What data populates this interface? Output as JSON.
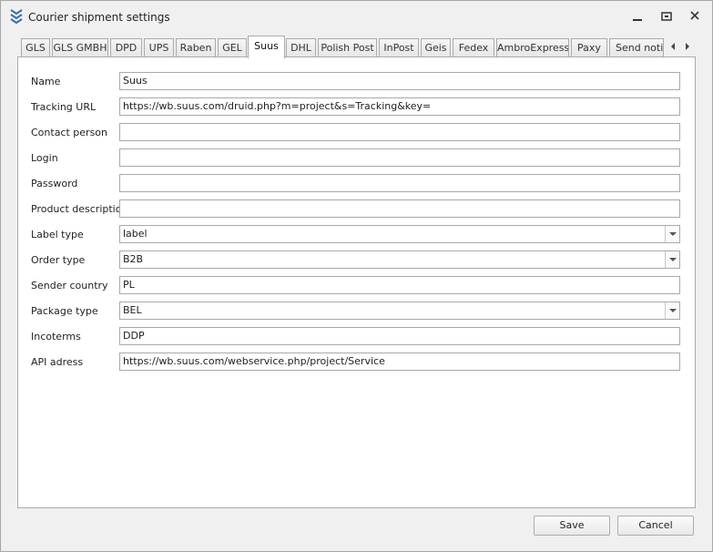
{
  "window": {
    "title": "Courier shipment settings"
  },
  "tabs": [
    {
      "label": "GLS",
      "active": false
    },
    {
      "label": "GLS GMBH",
      "active": false
    },
    {
      "label": "DPD",
      "active": false
    },
    {
      "label": "UPS",
      "active": false
    },
    {
      "label": "Raben",
      "active": false
    },
    {
      "label": "GEL",
      "active": false
    },
    {
      "label": "Suus",
      "active": true
    },
    {
      "label": "DHL",
      "active": false
    },
    {
      "label": "Polish Post",
      "active": false
    },
    {
      "label": "InPost",
      "active": false
    },
    {
      "label": "Geis",
      "active": false
    },
    {
      "label": "Fedex",
      "active": false
    },
    {
      "label": "AmbroExpress",
      "active": false
    },
    {
      "label": "Paxy",
      "active": false
    },
    {
      "label": "Send notifi",
      "active": false
    }
  ],
  "form": {
    "name": {
      "label": "Name",
      "value": "Suus"
    },
    "tracking": {
      "label": "Tracking URL",
      "value": "https://wb.suus.com/druid.php?m=project&s=Tracking&key="
    },
    "contact": {
      "label": "Contact person",
      "value": ""
    },
    "login": {
      "label": "Login",
      "value": ""
    },
    "password": {
      "label": "Password",
      "value": ""
    },
    "product": {
      "label": "Product description",
      "value": ""
    },
    "label_type": {
      "label": "Label type",
      "value": "label"
    },
    "order_type": {
      "label": "Order type",
      "value": "B2B"
    },
    "sender": {
      "label": "Sender country",
      "value": "PL"
    },
    "package": {
      "label": "Package type",
      "value": "BEL"
    },
    "incoterms": {
      "label": "Incoterms",
      "value": "DDP"
    },
    "api": {
      "label": "API adress",
      "value": "https://wb.suus.com/webservice.php/project/Service"
    }
  },
  "buttons": {
    "save": "Save",
    "cancel": "Cancel"
  },
  "colors": {
    "accent_icon": "#3a6ea8",
    "window_bg": "#f0f0f0",
    "panel_bg": "#ffffff",
    "border": "#ababab"
  },
  "icons": {
    "app": "stacked-chevrons-icon",
    "minimize": "minimize-icon",
    "restore": "restore-icon",
    "close": "close-icon",
    "tab_prev": "triangle-left-icon",
    "tab_next": "triangle-right-icon",
    "dropdown": "chevron-down-icon"
  }
}
